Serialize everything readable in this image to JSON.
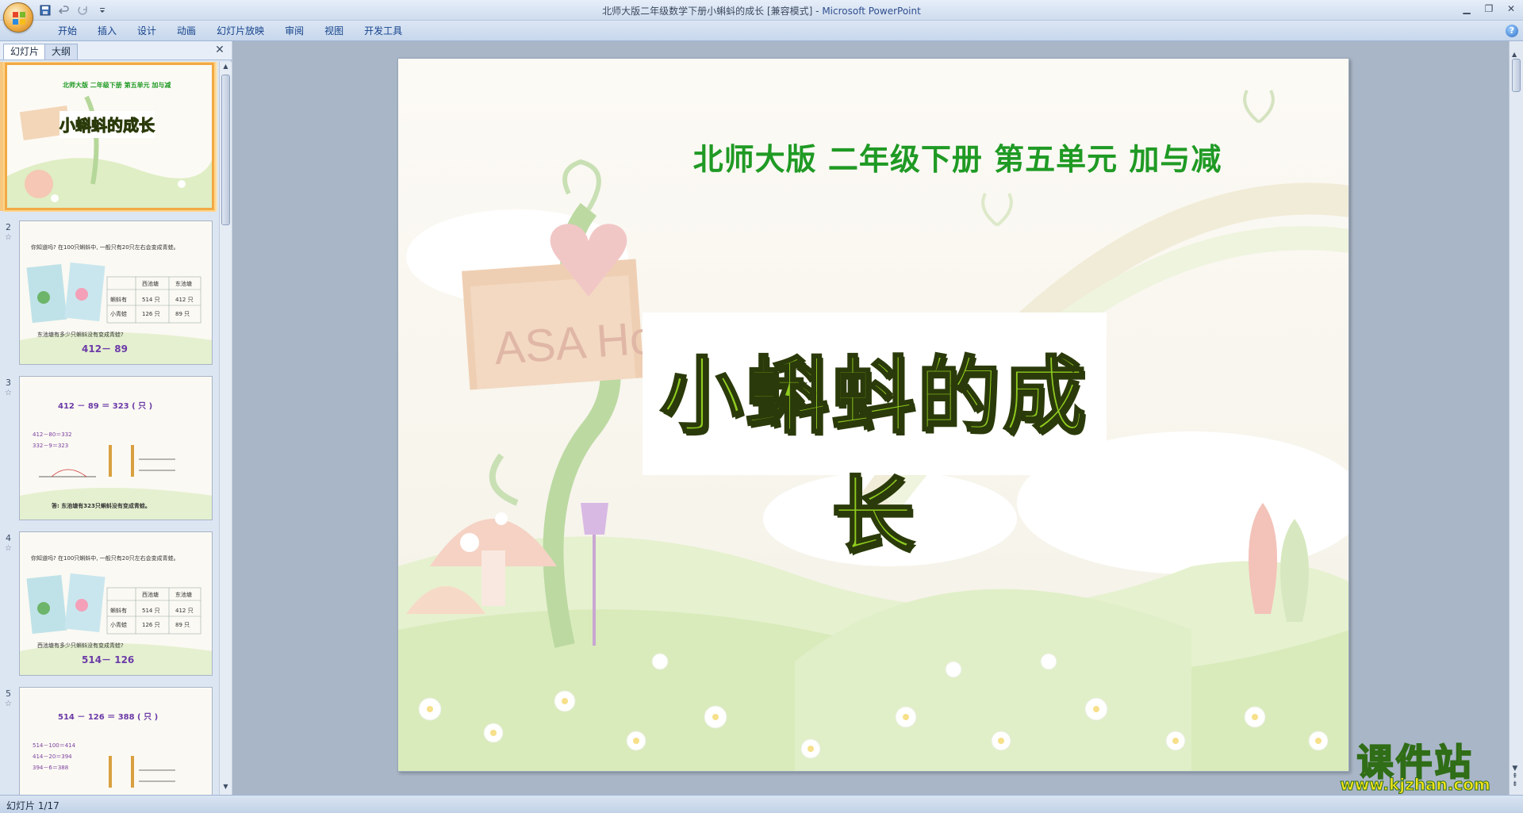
{
  "window": {
    "title": "北师大版二年级数学下册小蝌蚪的成长 [兼容模式]",
    "app_name": "Microsoft PowerPoint",
    "separator": " - "
  },
  "ribbon": {
    "tabs": [
      "开始",
      "插入",
      "设计",
      "动画",
      "幻灯片放映",
      "审阅",
      "视图",
      "开发工具"
    ]
  },
  "left_panel": {
    "tabs": [
      "幻灯片",
      "大纲"
    ],
    "active_tab": "幻灯片",
    "thumbnails": [
      {
        "number": "1",
        "header": "北师大版  二年级下册  第五单元  加与减",
        "title": "小蝌蚪的成长"
      },
      {
        "number": "2",
        "header": "你知道吗? 在100只蝌蚪中, 一般只有20只左右会变成青蛙。",
        "question": "东池塘有多少只蝌蚪没有变成青蛙?",
        "expression": "412－ 89",
        "table": [
          [
            "",
            "西池塘",
            "东池塘"
          ],
          [
            "蝌蚪有",
            "514 只",
            "412 只"
          ],
          [
            "小青蛙",
            "126 只",
            "89 只"
          ]
        ]
      },
      {
        "number": "3",
        "equation": [
          "412",
          "－",
          "89",
          "＝",
          "323",
          "( 只 )"
        ],
        "lines": [
          "412－80＝332",
          "332－9＝323"
        ],
        "answer": "答: 东池塘有323只蝌蚪没有变成青蛙。"
      },
      {
        "number": "4",
        "header": "你知道吗? 在100只蝌蚪中, 一般只有20只左右会变成青蛙。",
        "question": "西池塘有多少只蝌蚪没有变成青蛙?",
        "expression": "514－ 126",
        "table": [
          [
            "",
            "西池塘",
            "东池塘"
          ],
          [
            "蝌蚪有",
            "514 只",
            "412 只"
          ],
          [
            "小青蛙",
            "126 只",
            "89 只"
          ]
        ]
      },
      {
        "number": "5",
        "equation": [
          "514",
          "－",
          "126",
          "＝",
          "388",
          "( 只 )"
        ],
        "lines": [
          "514－100＝414",
          "414－20＝394",
          "394－6＝388"
        ]
      }
    ]
  },
  "slide": {
    "subtitle": "北师大版  二年级下册  第五单元  加与减",
    "title": "小蝌蚪的成长",
    "sign_text": "ASA Hou"
  },
  "status_bar": {
    "slide_indicator": "幻灯片 1/17"
  },
  "watermark": {
    "main": "课件站",
    "url": "www.kjzhan.com"
  },
  "colors": {
    "subtitle_green": "#1f9a24",
    "title_green": "#8fcc1f",
    "selection_orange": "#f2a945",
    "ribbon_text": "#15428b"
  }
}
